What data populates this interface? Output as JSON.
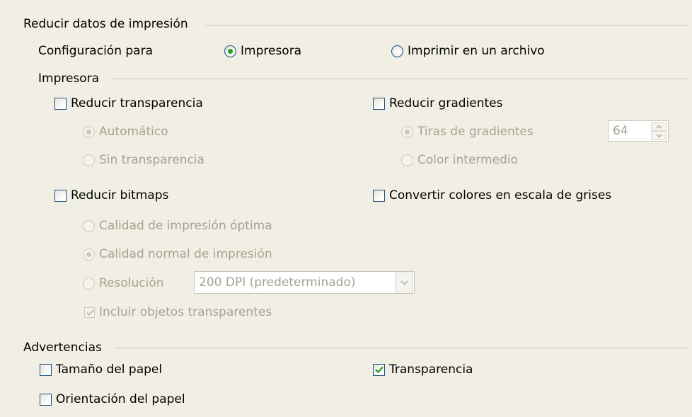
{
  "reduce_section": {
    "title": "Reducir datos de impresión",
    "config_label": "Configuración para",
    "options": [
      {
        "label": "Impresora",
        "selected": true
      },
      {
        "label": "Imprimir en un archivo",
        "selected": false
      }
    ]
  },
  "printer_section": {
    "title": "Impresora",
    "reduce_transparency": {
      "label": "Reducir transparencia",
      "checked": false,
      "options": [
        {
          "label": "Automático",
          "selected": true
        },
        {
          "label": "Sin transparencia",
          "selected": false
        }
      ]
    },
    "reduce_gradients": {
      "label": "Reducir gradientes",
      "checked": false,
      "options": [
        {
          "label": "Tiras de gradientes",
          "selected": true
        },
        {
          "label": "Color intermedio",
          "selected": false
        }
      ],
      "stripes_value": "64"
    },
    "reduce_bitmaps": {
      "label": "Reducir bitmaps",
      "checked": false,
      "options": [
        {
          "label": "Calidad de impresión óptima",
          "selected": false
        },
        {
          "label": "Calidad normal de impresión",
          "selected": true
        },
        {
          "label": "Resolución",
          "selected": false
        }
      ],
      "resolution_value": "200 DPI (predeterminado)",
      "include_transparent": {
        "label": "Incluir objetos transparentes",
        "checked": true
      }
    },
    "grayscale": {
      "label": "Convertir colores en escala de grises",
      "checked": false
    }
  },
  "warnings_section": {
    "title": "Advertencias",
    "items": [
      {
        "label": "Tamaño del papel",
        "checked": false
      },
      {
        "label": "Orientación del papel",
        "checked": false
      },
      {
        "label": "Transparencia",
        "checked": true
      }
    ]
  },
  "colors": {
    "background": "#f1efe4",
    "accent": "#1c5180",
    "radio_dot": "#21a121",
    "check_mark": "#21a121",
    "disabled_text": "#a5a392"
  }
}
